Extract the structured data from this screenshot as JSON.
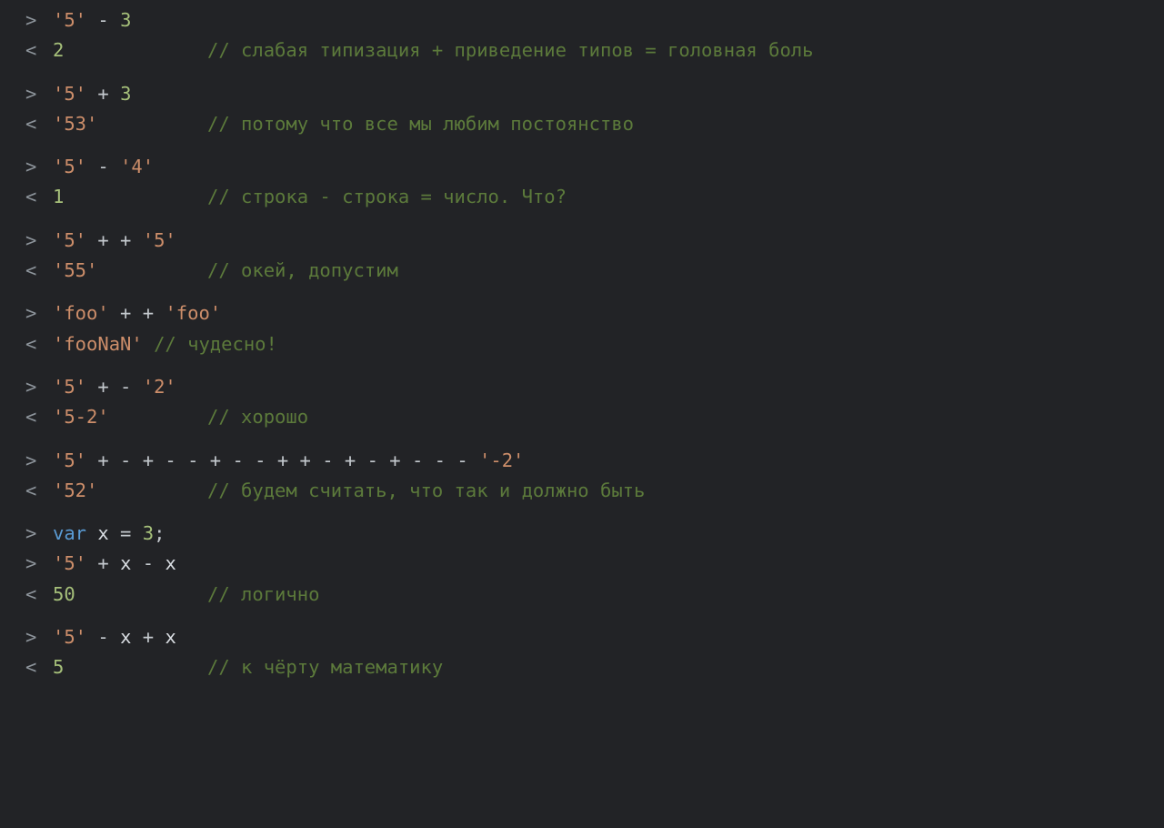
{
  "colors": {
    "background": "#222326",
    "gutter": "#8d949b",
    "string": "#cd8e6a",
    "number": "#a6c07a",
    "operator": "#c4c9ce",
    "keyword": "#5a9bd4",
    "identifier": "#d9dde2",
    "comment": "#5c7a3b"
  },
  "groups": [
    {
      "input": [
        {
          "t": "str",
          "v": "'5'"
        },
        {
          "t": "op",
          "v": " - "
        },
        {
          "t": "num",
          "v": "3"
        }
      ],
      "output": [
        {
          "t": "num",
          "v": "2"
        }
      ],
      "comment": "// слабая типизация + приведение типов = головная боль"
    },
    {
      "input": [
        {
          "t": "str",
          "v": "'5'"
        },
        {
          "t": "op",
          "v": " + "
        },
        {
          "t": "num",
          "v": "3"
        }
      ],
      "output": [
        {
          "t": "str",
          "v": "'53'"
        }
      ],
      "comment": "// потому что все мы любим постоянство"
    },
    {
      "input": [
        {
          "t": "str",
          "v": "'5'"
        },
        {
          "t": "op",
          "v": " - "
        },
        {
          "t": "str",
          "v": "'4'"
        }
      ],
      "output": [
        {
          "t": "num",
          "v": "1"
        }
      ],
      "comment": "// строка - строка = число. Что?"
    },
    {
      "input": [
        {
          "t": "str",
          "v": "'5'"
        },
        {
          "t": "op",
          "v": " + + "
        },
        {
          "t": "str",
          "v": "'5'"
        }
      ],
      "output": [
        {
          "t": "str",
          "v": "'55'"
        }
      ],
      "comment": "// окей, допустим"
    },
    {
      "input": [
        {
          "t": "str",
          "v": "'foo'"
        },
        {
          "t": "op",
          "v": " + + "
        },
        {
          "t": "str",
          "v": "'foo'"
        }
      ],
      "output": [
        {
          "t": "str",
          "v": "'fooNaN'"
        }
      ],
      "output_wide": true,
      "comment": "// чудесно!"
    },
    {
      "input": [
        {
          "t": "str",
          "v": "'5'"
        },
        {
          "t": "op",
          "v": " + - "
        },
        {
          "t": "str",
          "v": "'2'"
        }
      ],
      "output": [
        {
          "t": "str",
          "v": "'5-2'"
        }
      ],
      "comment": "// хорошо"
    },
    {
      "input": [
        {
          "t": "str",
          "v": "'5'"
        },
        {
          "t": "op",
          "v": " + - + - - + - - + + - + - + - - - "
        },
        {
          "t": "str",
          "v": "'-2'"
        }
      ],
      "output": [
        {
          "t": "str",
          "v": "'52'"
        }
      ],
      "comment": "// будем считать, что так и должно быть"
    },
    {
      "extra_inputs": [
        [
          {
            "t": "kw",
            "v": "var"
          },
          {
            "t": "op",
            "v": " "
          },
          {
            "t": "var",
            "v": "x"
          },
          {
            "t": "op",
            "v": " = "
          },
          {
            "t": "num",
            "v": "3"
          },
          {
            "t": "op",
            "v": ";"
          }
        ]
      ],
      "input": [
        {
          "t": "str",
          "v": "'5'"
        },
        {
          "t": "op",
          "v": " + "
        },
        {
          "t": "var",
          "v": "x"
        },
        {
          "t": "op",
          "v": " - "
        },
        {
          "t": "var",
          "v": "x"
        }
      ],
      "output": [
        {
          "t": "num",
          "v": "50"
        }
      ],
      "comment": "// логично"
    },
    {
      "input": [
        {
          "t": "str",
          "v": "'5'"
        },
        {
          "t": "op",
          "v": " - "
        },
        {
          "t": "var",
          "v": "x"
        },
        {
          "t": "op",
          "v": " + "
        },
        {
          "t": "var",
          "v": "x"
        }
      ],
      "output": [
        {
          "t": "num",
          "v": "5"
        }
      ],
      "comment": "// к чёрту математику"
    }
  ],
  "prompts": {
    "in": ">",
    "out": "<"
  }
}
